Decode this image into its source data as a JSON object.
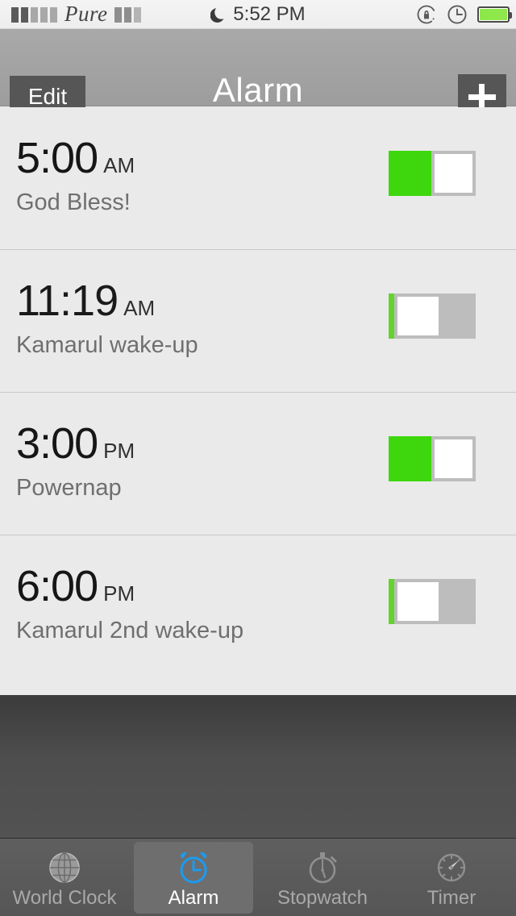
{
  "status_bar": {
    "signal_bars_total": 5,
    "signal_bars_filled": 2,
    "carrier": "Pure",
    "wifi_bars_total": 3,
    "wifi_bars_filled": 2,
    "time": "5:52 PM",
    "moon_icon": "crescent-moon-icon",
    "rotation_lock_icon": "rotation-lock-icon",
    "alarm_indicator_icon": "clock-icon",
    "battery_icon": "battery-icon",
    "battery_color": "#8ee84b"
  },
  "nav_bar": {
    "edit_label": "Edit",
    "title": "Alarm",
    "add_label": "+",
    "background_color": "#a3a3a3"
  },
  "alarms": [
    {
      "time": "5:00",
      "meridiem": "AM",
      "label": "God Bless!",
      "enabled": true,
      "toggle_state": "on"
    },
    {
      "time": "11:19",
      "meridiem": "AM",
      "label": "Kamarul wake-up",
      "enabled": false,
      "toggle_state": "off"
    },
    {
      "time": "3:00",
      "meridiem": "PM",
      "label": "Powernap",
      "enabled": true,
      "toggle_state": "on"
    },
    {
      "time": "6:00",
      "meridiem": "PM",
      "label": "Kamarul 2nd wake-up",
      "enabled": false,
      "toggle_state": "off"
    }
  ],
  "tab_bar": {
    "active_index": 1,
    "accent_color": "#1b9bf0",
    "items": [
      {
        "label": "World Clock",
        "icon": "globe-icon"
      },
      {
        "label": "Alarm",
        "icon": "alarm-clock-icon"
      },
      {
        "label": "Stopwatch",
        "icon": "stopwatch-icon"
      },
      {
        "label": "Timer",
        "icon": "timer-gauge-icon"
      }
    ]
  }
}
